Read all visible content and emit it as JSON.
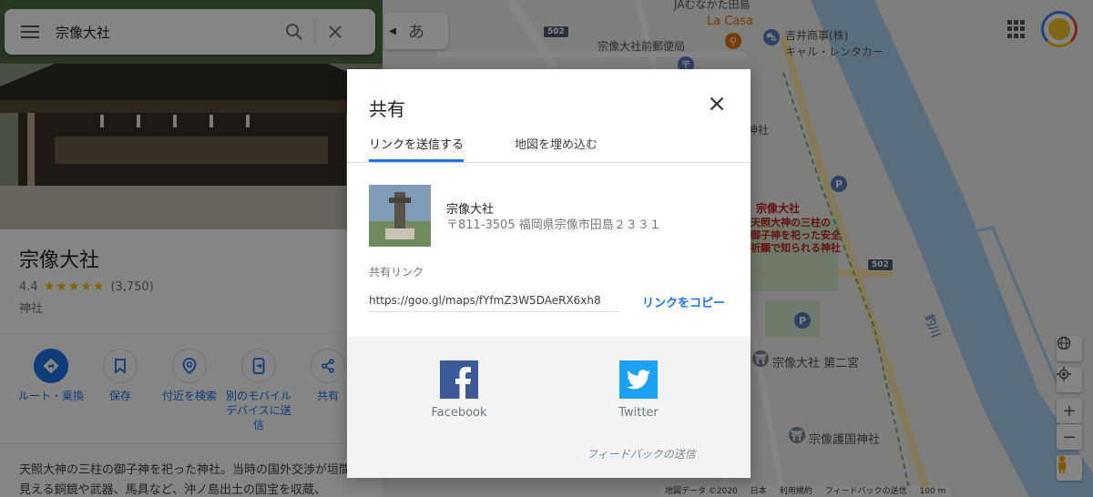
{
  "search": {
    "query": "宗像大社"
  },
  "map": {
    "ime_label": "あ",
    "labels": {
      "ja_top": "JAむなかた田島",
      "la_casa": "La Casa",
      "yoshii": "吉井商事(株)",
      "car_rental": "キャル・レンタカー",
      "post_office": "宗像大社前郵便局",
      "jinja_partial": "神社",
      "taisha_label": "宗像大社",
      "taisha_desc": [
        "天照大神の三柱の",
        "御子神を祀った安全",
        "祈願で知られる神社"
      ],
      "second_shrine": "宗像大社 第二宮",
      "gokoku": "宗像護国神社",
      "river": "釣川",
      "route_502": "502"
    },
    "attribution": {
      "map_data": "地図データ ©2020",
      "country": "日本",
      "terms": "利用規約",
      "feedback": "フィードバックの送信",
      "scale": "100 m"
    }
  },
  "place": {
    "title": "宗像大社",
    "rating": "4.4",
    "stars": "★★★★★",
    "reviews": "(3,750)",
    "category": "神社",
    "description": "天照大神の三柱の御子神を祀った神社。当時の国外交渉が垣間見える銅鏡や武器、馬具など、沖ノ島出土の国宝を収蔵、"
  },
  "actions": [
    {
      "label": "ルート・乗換"
    },
    {
      "label": "保存"
    },
    {
      "label": "付近を検索"
    },
    {
      "label": "別のモバイルデバイスに送信"
    },
    {
      "label": "共有"
    }
  ],
  "dialog": {
    "title": "共有",
    "tabs": [
      {
        "label": "リンクを送信する"
      },
      {
        "label": "地図を埋め込む"
      }
    ],
    "place_name": "宗像大社",
    "place_address": "〒811-3505 福岡県宗像市田島２３３１",
    "link_label": "共有リンク",
    "link_value": "https://goo.gl/maps/fYfmZ3W5DAeRX6xh8",
    "copy_label": "リンクをコピー",
    "social": [
      {
        "label": "Facebook"
      },
      {
        "label": "Twitter"
      }
    ],
    "feedback": "フィードバックの送信"
  },
  "colors": {
    "accent": "#1a73e8",
    "facebook": "#3b5998",
    "twitter": "#1da1f2",
    "star": "#fbbc04",
    "river": "#aad3f1"
  }
}
